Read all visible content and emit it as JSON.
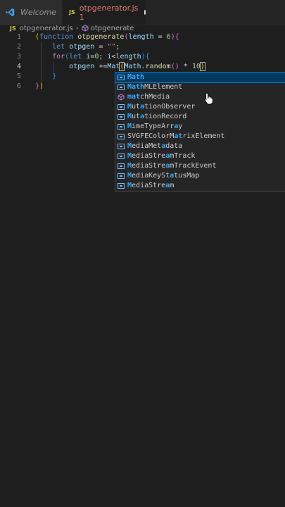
{
  "tabs": {
    "welcome_label": "Welcome",
    "active_lang": "JS",
    "active_label": "otpgenerator.js 1"
  },
  "breadcrumb": {
    "lang": "JS",
    "file": "otpgenerator.js",
    "symbol": "otpgenerate"
  },
  "gutter": [
    "1",
    "2",
    "3",
    "4",
    "5",
    "6"
  ],
  "code_lines": {
    "l1": {
      "open": "(",
      "kw": "function ",
      "fn": "otpgenerate",
      "p": "(",
      "var": "length",
      "eq": " = ",
      "num": "6",
      "pc": ")",
      "br": "{"
    },
    "l2": {
      "kw": "let ",
      "var": "otpgen",
      "eq": " = ",
      "str": "\"\"",
      "semi": ";"
    },
    "l3": {
      "kw": "for",
      "p": "(",
      "kw2": "let ",
      "var": "i",
      "eq": "=",
      "num": "0",
      "mid": "; ",
      "var2": "i",
      "lt": "<",
      "var3": "length",
      "pc": ")",
      "br": "{"
    },
    "l4": {
      "var": "otpgen",
      "op": " +=",
      "typed": "Mat",
      "p": "(",
      "obj": "Math",
      "dot": ".",
      "fn": "random",
      "call": "()",
      "mul": " * ",
      "num": "10",
      "pc": ")"
    },
    "l5": {
      "br": "}"
    },
    "l6": {
      "br": "}",
      "pc": ")"
    }
  },
  "suggestions": [
    {
      "match": "Math",
      "rest": "",
      "kind": "symbol"
    },
    {
      "match": "Math",
      "rest": "MLElement",
      "kind": "symbol"
    },
    {
      "match": "mat",
      "rest": "chMedia",
      "kind": "method"
    },
    {
      "match": "M",
      "rest": "ut",
      "match2": "a",
      "rest2": "tionObserver",
      "kind": "symbol"
    },
    {
      "match": "M",
      "rest": "ut",
      "match2": "a",
      "rest2": "tionRecord",
      "kind": "symbol"
    },
    {
      "match": "M",
      "rest": "imeTypeArr",
      "match2": "a",
      "rest2": "y",
      "kind": "symbol"
    },
    {
      "match": "",
      "rest": "SVGFEColorM",
      "match2": "at",
      "rest2": "rixElement",
      "kind": "symbol"
    },
    {
      "match": "M",
      "rest": "ediaMet",
      "match2": "a",
      "rest2": "data",
      "kind": "symbol"
    },
    {
      "match": "M",
      "rest": "ediaStre",
      "match2": "a",
      "rest2": "mTrack",
      "kind": "symbol"
    },
    {
      "match": "M",
      "rest": "ediaStre",
      "match2": "a",
      "rest2": "mTrackEvent",
      "kind": "symbol"
    },
    {
      "match": "M",
      "rest": "ediaKeySt",
      "match2": "a",
      "rest2": "tusMap",
      "kind": "symbol"
    },
    {
      "match": "M",
      "rest": "ediaStre",
      "match2": "a",
      "rest2": "m",
      "kind": "symbol"
    }
  ],
  "colors": {
    "editor_bg": "#1e1e1e",
    "suggest_selected": "#04395e",
    "match_highlight": "#2aaaff",
    "dirty_tab_text": "#e07b6c"
  }
}
